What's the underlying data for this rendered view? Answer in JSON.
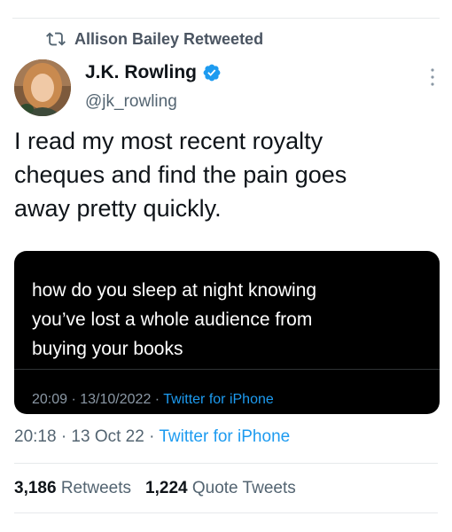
{
  "retweet": {
    "label": "Allison Bailey Retweeted",
    "icon": "retweet-icon"
  },
  "author": {
    "name": "J.K. Rowling",
    "handle": "@jk_rowling",
    "verified": true,
    "verified_color": "#1d9bf0"
  },
  "tweet": {
    "text": "I read my most recent royalty\ncheques and find the pain goes\naway pretty quickly."
  },
  "quoted": {
    "text": "how do you sleep at night knowing\nyou’ve lost a whole audience from\nbuying your books",
    "time": "20:09 · 13/10/2022 · ",
    "source": "Twitter for iPhone"
  },
  "meta": {
    "time": "20:18 · 13 Oct 22 · ",
    "source": "Twitter for iPhone"
  },
  "stats": {
    "retweets_count": "3,186",
    "retweets_label": "Retweets",
    "quotes_count": "1,224",
    "quotes_label": "Quote Tweets"
  },
  "colors": {
    "link": "#1d9bf0",
    "muted": "#536471",
    "text": "#0f1419",
    "quote_bg": "#000000"
  }
}
